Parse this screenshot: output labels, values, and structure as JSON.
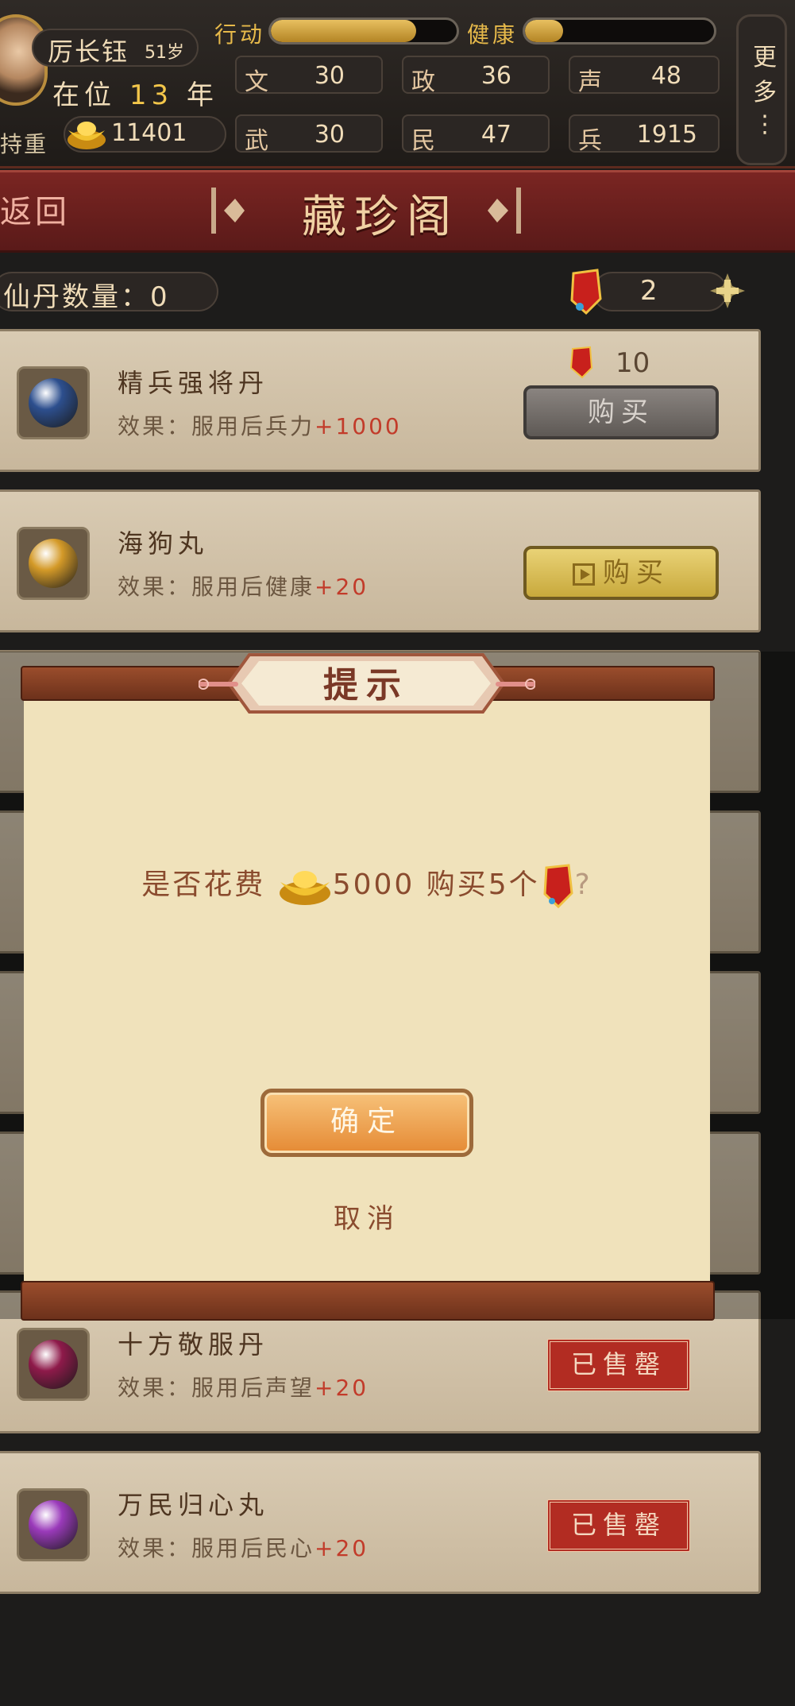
{
  "player": {
    "name": "厉长钰",
    "age": "51岁",
    "reign_prefix": "在位",
    "reign_years": "13",
    "reign_suffix": "年",
    "title_partial": "持重",
    "gold": "11401"
  },
  "bars": {
    "action_label": "行动",
    "action_fill": 0.78,
    "health_label": "健康",
    "health_fill": 0.2
  },
  "stats": [
    {
      "key": "文",
      "value": "30"
    },
    {
      "key": "政",
      "value": "36"
    },
    {
      "key": "声",
      "value": "48"
    },
    {
      "key": "武",
      "value": "30"
    },
    {
      "key": "民",
      "value": "47"
    },
    {
      "key": "兵",
      "value": "1915"
    }
  ],
  "more": {
    "line1": "更",
    "line2": "多",
    "dots": "⋮"
  },
  "nav": {
    "back_label": "返回",
    "title": "藏珍阁"
  },
  "counters": {
    "pill_label": "仙丹数量：0",
    "token_count": "2"
  },
  "items": [
    {
      "name": "精兵强将丹",
      "desc_prefix": "效果：服用后兵力",
      "desc_value": "+1000",
      "price": "10",
      "button": "购买",
      "state": "locked",
      "orb": "#2d4f8e"
    },
    {
      "name": "海狗丸",
      "desc_prefix": "效果：服用后健康",
      "desc_value": "+20",
      "button": "购买",
      "state": "ad",
      "orb": "#d49a28"
    },
    {
      "name": "十方敬服丹",
      "desc_prefix": "效果：服用后声望",
      "desc_value": "+20",
      "button": "已售罄",
      "state": "sold",
      "orb": "#8e1a4a"
    },
    {
      "name": "万民归心丸",
      "desc_prefix": "效果：服用后民心",
      "desc_value": "+20",
      "button": "已售罄",
      "state": "sold",
      "orb": "#9a3aba"
    }
  ],
  "dialog": {
    "title": "提示",
    "msg_prefix": "是否花费",
    "msg_amount": "5000",
    "msg_mid": "购买5个",
    "msg_suffix": "?",
    "confirm": "确定",
    "cancel": "取消"
  },
  "colors": {
    "accent_gold": "#e6b94a",
    "banner_red": "#7a2522",
    "value_red": "#c23b2a",
    "dialog_paper": "#f0e2bb",
    "confirm_orange": "#e58a34"
  }
}
